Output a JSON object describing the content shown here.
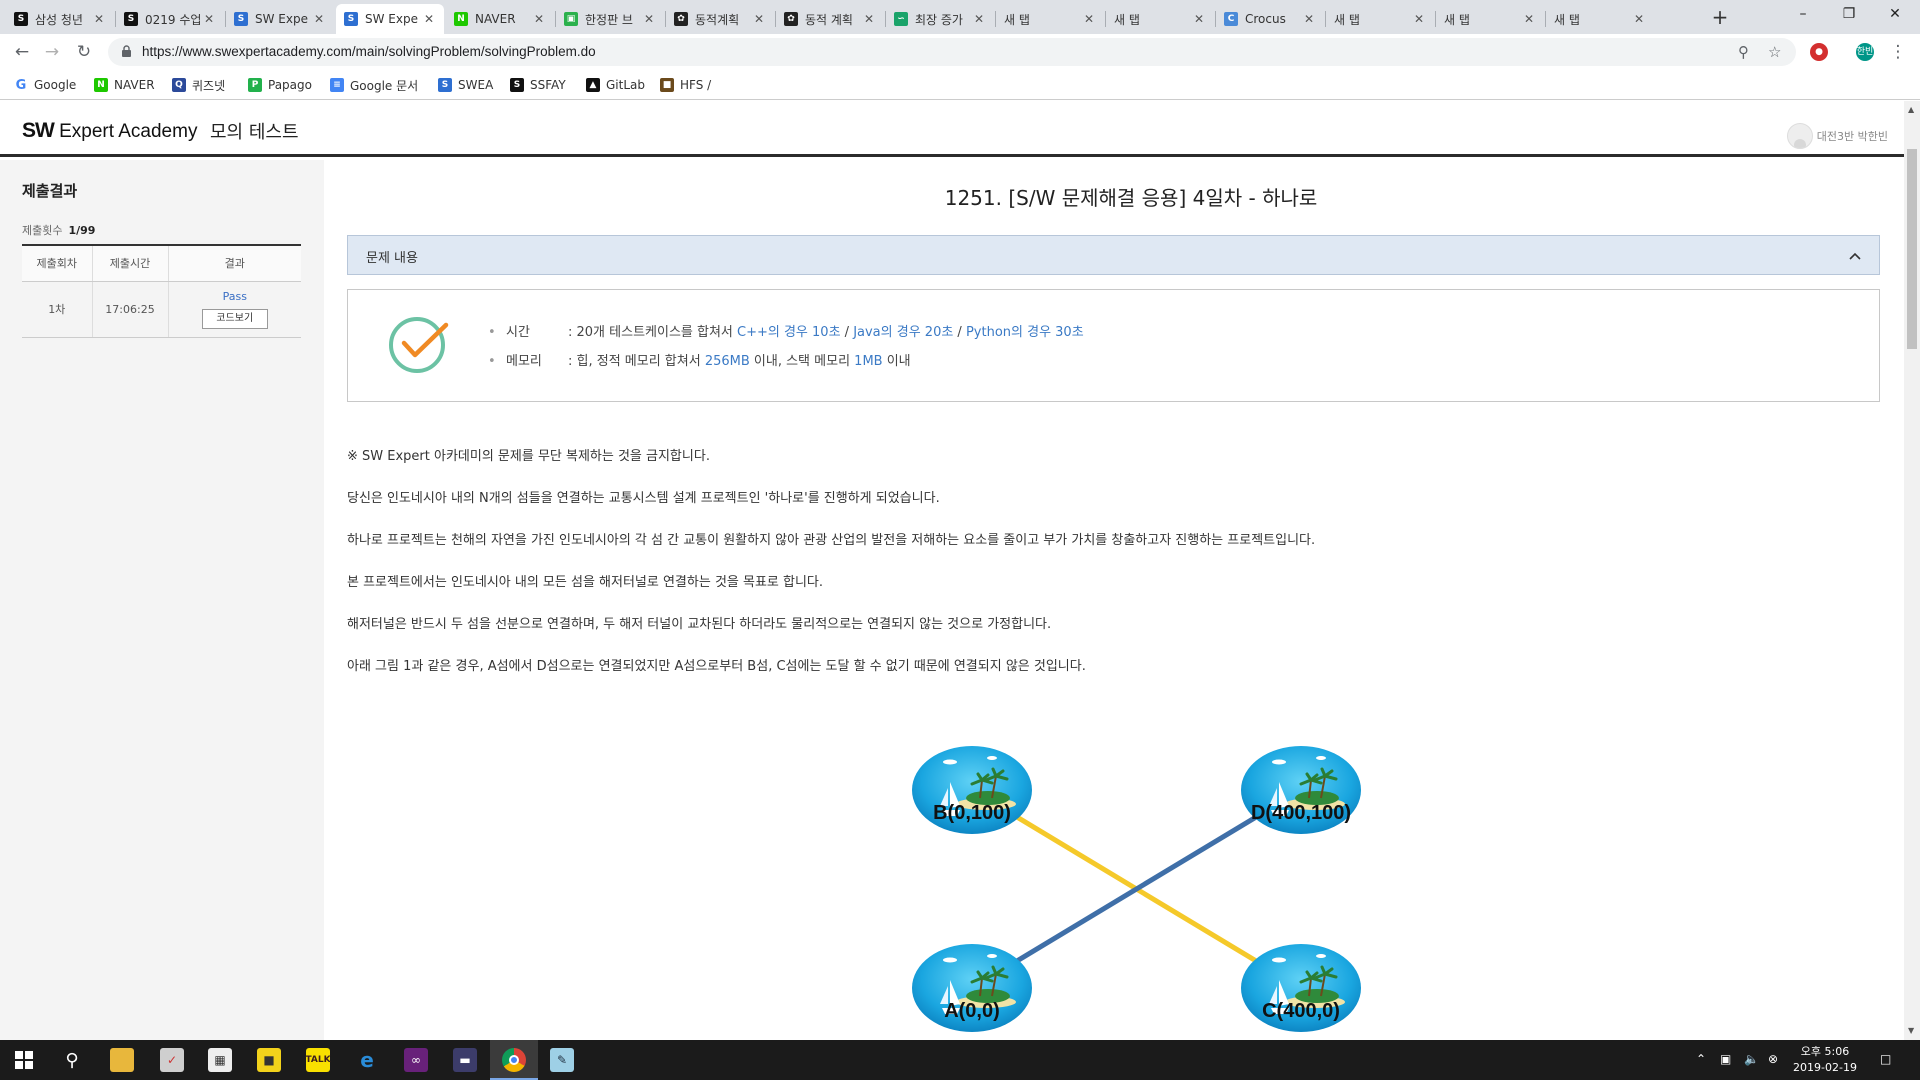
{
  "browser": {
    "tabs": [
      {
        "title": "삼성 청년",
        "favicon": "ssafy-icon",
        "active": false
      },
      {
        "title": "0219 수업",
        "favicon": "ssafy-icon",
        "active": false
      },
      {
        "title": "SW Expe",
        "favicon": "swea-icon",
        "active": false
      },
      {
        "title": "SW Expe",
        "favicon": "swea-icon",
        "active": true
      },
      {
        "title": "NAVER",
        "favicon": "naver-icon",
        "active": false
      },
      {
        "title": "한정판 브",
        "favicon": "shop-icon",
        "active": false
      },
      {
        "title": "동적계획",
        "favicon": "paw-icon",
        "active": false
      },
      {
        "title": "동적 계획",
        "favicon": "paw-icon",
        "active": false
      },
      {
        "title": "최장 증가",
        "favicon": "green-icon",
        "active": false
      },
      {
        "title": "새 탭",
        "favicon": "",
        "active": false
      },
      {
        "title": "새 탭",
        "favicon": "",
        "active": false
      },
      {
        "title": "Crocus",
        "favicon": "crocus-icon",
        "active": false
      },
      {
        "title": "새 탭",
        "favicon": "",
        "active": false
      },
      {
        "title": "새 탭",
        "favicon": "",
        "active": false
      },
      {
        "title": "새 탭",
        "favicon": "",
        "active": false
      }
    ],
    "url": "https://www.swexpertacademy.com/main/solvingProblem/solvingProblem.do",
    "profile_initials": "한빈",
    "bookmarks": [
      "Google",
      "NAVER",
      "퀴즈넷",
      "Papago",
      "Google 문서",
      "SWEA",
      "SSFAY",
      "GitLab",
      "HFS /"
    ]
  },
  "site": {
    "logo_bold": "SW",
    "logo_rest": "Expert Academy",
    "subtitle": "모의 테스트",
    "user_name": "대전3반 박한빈"
  },
  "sidebar": {
    "title": "제출결과",
    "count_label": "제출횟수",
    "count_value": "1/99",
    "headers": [
      "제출회차",
      "제출시간",
      "결과"
    ],
    "rows": [
      {
        "round": "1차",
        "time": "17:06:25",
        "result": "Pass",
        "button": "코드보기"
      }
    ]
  },
  "problem": {
    "title": "1251. [S/W 문제해결 응용] 4일차 - 하나로",
    "panel_label": "문제 내용",
    "time_label": "시간",
    "time_prefix": ": 20개 테스트케이스를 합쳐서 ",
    "time_cpp": "C++의 경우 10초",
    "time_java": "Java의 경우 20초",
    "time_python": "Python의 경우 30초",
    "time_sep": " / ",
    "mem_label": "메모리",
    "mem_prefix": ": 힙, 정적 메모리 합쳐서 ",
    "mem_heap": "256MB",
    "mem_mid": " 이내, 스택 메모리 ",
    "mem_stack": "1MB",
    "mem_suffix": " 이내",
    "paragraphs": [
      "※ SW Expert 아카데미의 문제를 무단 복제하는 것을 금지합니다.",
      "당신은 인도네시아 내의 N개의 섬들을 연결하는 교통시스템 설계 프로젝트인 '하나로'를 진행하게 되었습니다.",
      "하나로 프로젝트는 천해의 자연을 가진 인도네시아의 각 섬 간 교통이 원활하지 않아 관광 산업의 발전을 저해하는 요소를 줄이고 부가 가치를 창출하고자 진행하는 프로젝트입니다.",
      "본 프로젝트에서는 인도네시아 내의 모든 섬을 해저터널로 연결하는 것을 목표로 합니다.",
      "해저터널은 반드시 두 섬을 선분으로 연결하며, 두 해저 터널이 교차된다 하더라도 물리적으로는 연결되지 않는 것으로 가정합니다.",
      "아래 그림 1과 같은 경우, A섬에서 D섬으로는 연결되었지만 A섬으로부터 B섬, C섬에는 도달 할 수 없기 때문에 연결되지 않은 것입니다."
    ],
    "diagram": {
      "islands": [
        "B(0,100)",
        "D(400,100)",
        "A(0,0)",
        "C(400,0)"
      ],
      "tunnel_colors": {
        "B-C": "#f5c92a",
        "A-D": "#3f6fa8"
      }
    }
  },
  "taskbar": {
    "time": "오후 5:06",
    "date": "2019-02-19"
  }
}
